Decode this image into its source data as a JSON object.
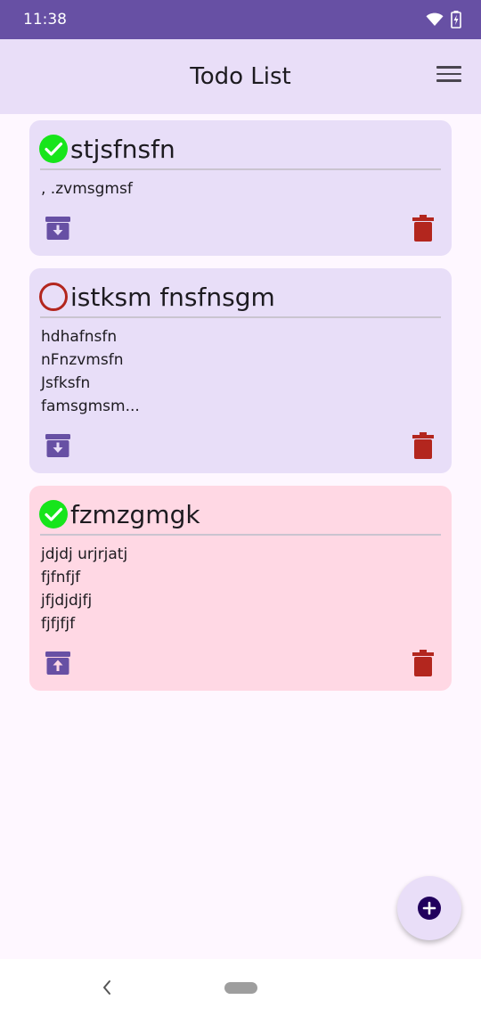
{
  "status_bar": {
    "time": "11:38",
    "wifi_icon": "wifi-icon",
    "battery_icon": "battery-charging-icon"
  },
  "app_bar": {
    "title": "Todo List",
    "menu_icon": "menu-icon"
  },
  "colors": {
    "primary": "#6750a4",
    "app_bar_bg": "#e9def8",
    "card_default": "#e8def8",
    "card_highlight": "#ffd8e4",
    "done_green": "#17e51b",
    "pending_red": "#b3261e",
    "delete_red": "#b3261e"
  },
  "todos": [
    {
      "title": "stjsfnsfn",
      "completed": true,
      "lines": [
        ", .zvmsgmsf"
      ],
      "action_icon": "archive-down-icon"
    },
    {
      "title": "istksm fnsfnsgm",
      "completed": false,
      "lines": [
        "hdhafnsfn",
        "nFnzvmsfn",
        "Jsfksfn",
        "famsgmsm..."
      ],
      "action_icon": "archive-down-icon"
    },
    {
      "title": "fzmzgmgk",
      "completed": true,
      "lines": [
        "jdjdj urjrjatj",
        "fjfnfjf",
        "jfjdjdjfj",
        "fjfjfjf"
      ],
      "action_icon": "unarchive-up-icon"
    }
  ],
  "fab": {
    "icon": "add-circle-icon"
  },
  "nav_bar": {
    "back_icon": "back-chevron-icon",
    "home_pill": "home-pill"
  }
}
